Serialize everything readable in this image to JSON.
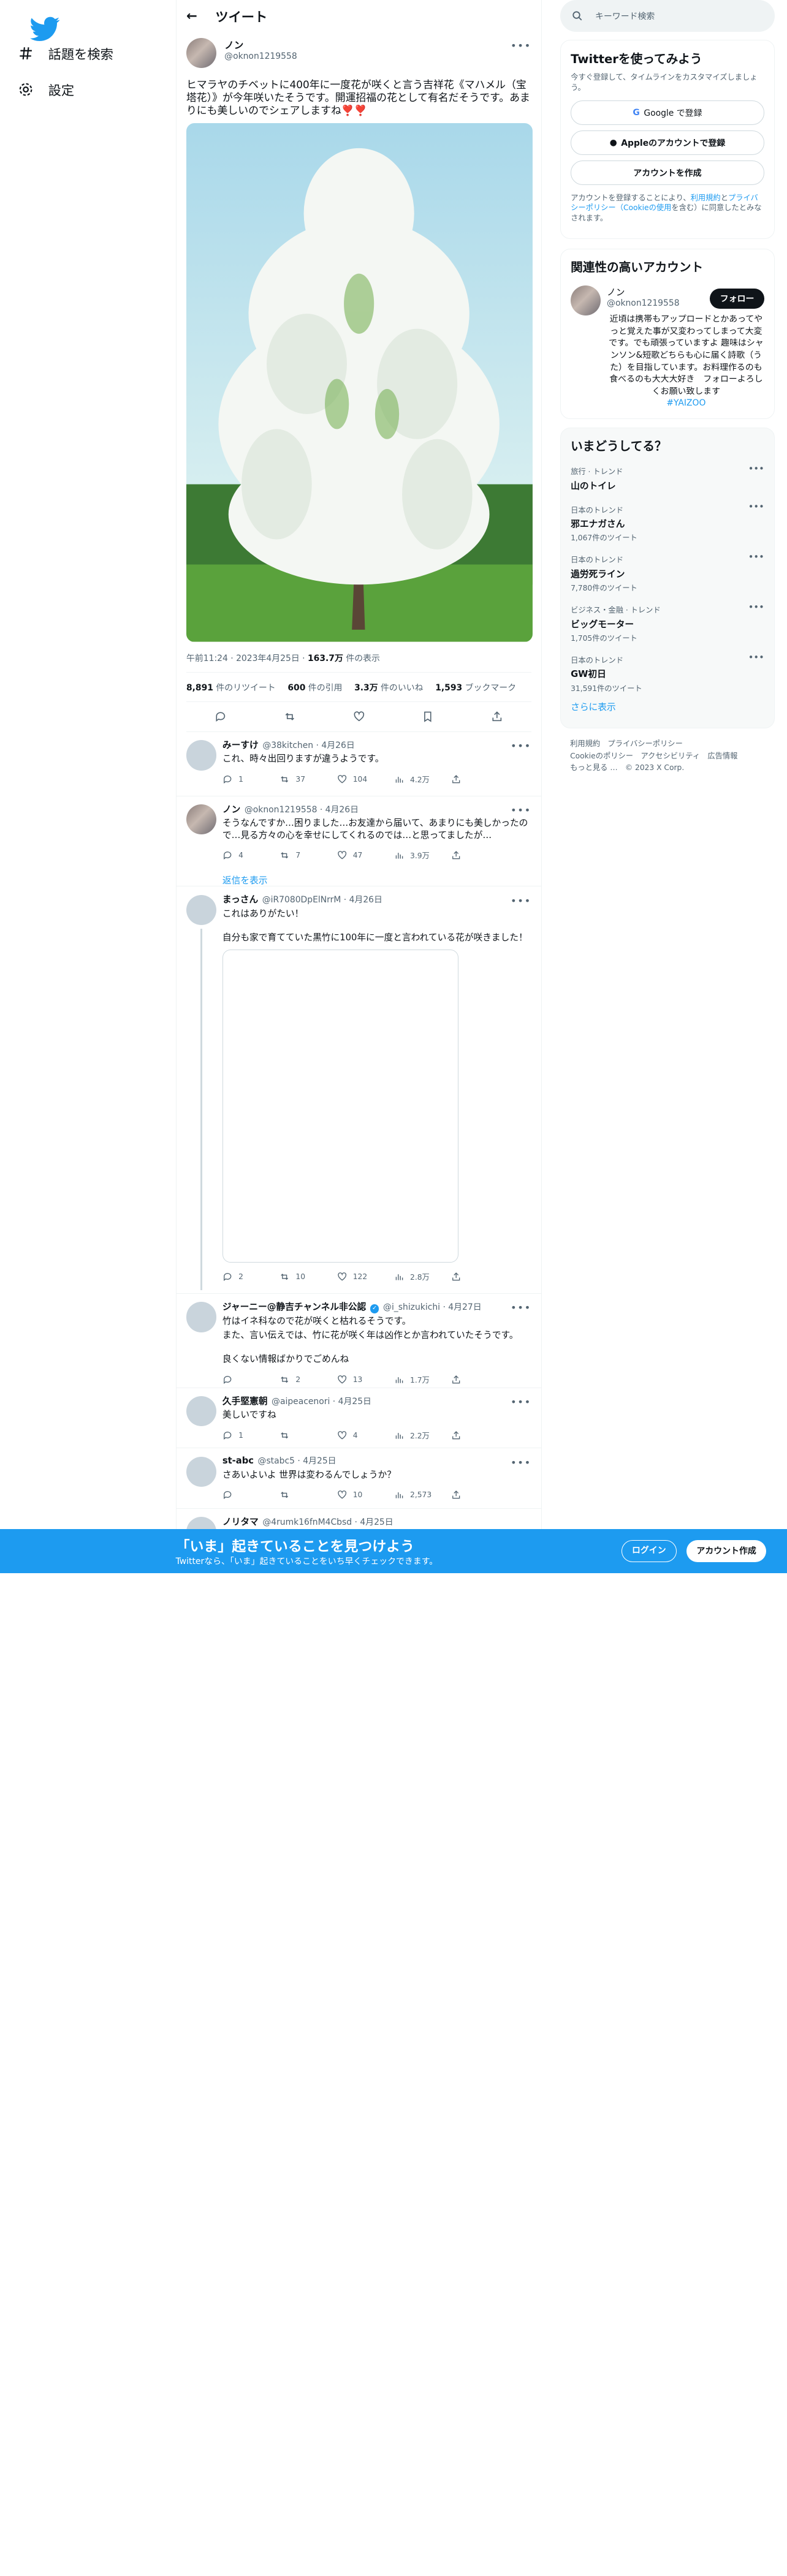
{
  "nav": {
    "explore": "話題を検索",
    "settings": "設定"
  },
  "header": {
    "title": "ツイート"
  },
  "main_tweet": {
    "name": "ノン",
    "handle": "@oknon1219558",
    "text": "ヒマラヤのチベットに400年に一度花が咲くと言う吉祥花《マハメル（宝塔花）》が今年咲いたそうです。開運招福の花として有名だそうです。あまりにも美しいのでシェアしますね❣️❣️",
    "time": "午前11:24 · 2023年4月25日 · ",
    "views": "163.7万",
    "views_label": " 件の表示",
    "retweets": "8,891",
    "retweets_label": " 件のリツイート",
    "quotes": "600",
    "quotes_label": " 件の引用",
    "likes": "3.3万",
    "likes_label": " 件のいいね",
    "bookmarks": "1,593",
    "bookmarks_label": " ブックマーク"
  },
  "replies": [
    {
      "name": "みーすけ",
      "handle": "@38kitchen · 4月26日",
      "text": "これ、時々出回りますが違うようです。",
      "reply": "1",
      "rt": "37",
      "like": "104",
      "views": "4.2万"
    },
    {
      "name": "ノン",
      "handle": "@oknon1219558 · 4月26日",
      "text": "そうなんですか…困りました…お友達から届いて、あまりにも美しかったので…見る方々の心を幸せにしてくれるのでは…と思ってましたが…",
      "reply": "4",
      "rt": "7",
      "like": "47",
      "views": "3.9万",
      "show": "返信を表示"
    },
    {
      "name": "まっさん",
      "handle": "@iR7080DpElNrrM · 4月26日",
      "text1": "これはありがたい！",
      "text2": "自分も家で育てていた黒竹に100年に一度と言われている花が咲きました！",
      "reply": "2",
      "rt": "10",
      "like": "122",
      "views": "2.8万"
    },
    {
      "name": "ジャーニー@静吉チャンネル非公認",
      "handle": "@i_shizukichi · 4月27日",
      "text1": "竹はイネ科なので花が咲くと枯れるそうです。",
      "text2": "また、言い伝えでは、竹に花が咲く年は凶作とか言われていたそうです。",
      "text3": "良くない情報ばかりでごめんね",
      "reply": "",
      "rt": "2",
      "like": "13",
      "views": "1.7万"
    },
    {
      "name": "久手堅憲朝",
      "handle": "@aipeacenori · 4月25日",
      "text": "美しいですね",
      "reply": "1",
      "rt": "",
      "like": "4",
      "views": "2.2万"
    },
    {
      "name": "st-abc",
      "handle": "@stabc5 · 4月25日",
      "text": "さあいよいよ 世界は変わるんでしょうか？",
      "reply": "",
      "rt": "",
      "like": "10",
      "views": "2,573"
    },
    {
      "name": "ノリタマ",
      "handle": "@4rumk16fnM4Cbsd · 4月25日"
    }
  ],
  "right": {
    "search_placeholder": "キーワード検索",
    "signup_title": "Twitterを使ってみよう",
    "signup_sub": "今すぐ登録して、タイムラインをカスタマイズしましょう。",
    "google": "Google で登録",
    "apple": "Appleのアカウントで登録",
    "create": "アカウントを作成",
    "terms_a": "アカウントを登録することにより、",
    "terms_link1": "利用規約",
    "terms_b": "と",
    "terms_link2": "プライバシーポリシー（Cookieの使用",
    "terms_c": "を含む）に同意したとみなされます。",
    "related_title": "関連性の高いアカウント",
    "rel_name": "ノン",
    "rel_handle": "@oknon1219558",
    "follow": "フォロー",
    "rel_bio": "近頃は携帯もアップロードとかあってやっと覚えた事が又変わってしまって大変です。でも頑張っていますよ 趣味はシャンソン&短歌どちらも心に届く詩歌（うた）を目指しています。お料理作るのも食べるのも大大大好き　フォローよろしくお願い致します",
    "rel_tag": "#YAIZOO",
    "trends_title": "いまどうしてる？",
    "trends": [
      {
        "cat": "旅行 · トレンド",
        "title": "山のトイレ",
        "count": ""
      },
      {
        "cat": "日本のトレンド",
        "title": "邪エナガさん",
        "count": "1,067件のツイート"
      },
      {
        "cat": "日本のトレンド",
        "title": "過労死ライン",
        "count": "7,780件のツイート"
      },
      {
        "cat": "ビジネス・金融 · トレンド",
        "title": "ビッグモーター",
        "count": "1,705件のツイート"
      },
      {
        "cat": "日本のトレンド",
        "title": "GW初日",
        "count": "31,591件のツイート"
      }
    ],
    "show_more": "さらに表示",
    "footer1": "利用規約　プライバシーポリシー",
    "footer2": "Cookieのポリシー　アクセシビリティ　広告情報",
    "footer3": "もっと見る …　© 2023 X Corp."
  },
  "bottom": {
    "title": "「いま」起きていることを見つけよう",
    "sub": "Twitterなら、「いま」起きていることをいち早くチェックできます。",
    "login": "ログイン",
    "signup": "アカウント作成"
  },
  "colors": {
    "brand": "#1d9bf0",
    "text": "#0f1419",
    "muted": "#536471"
  }
}
